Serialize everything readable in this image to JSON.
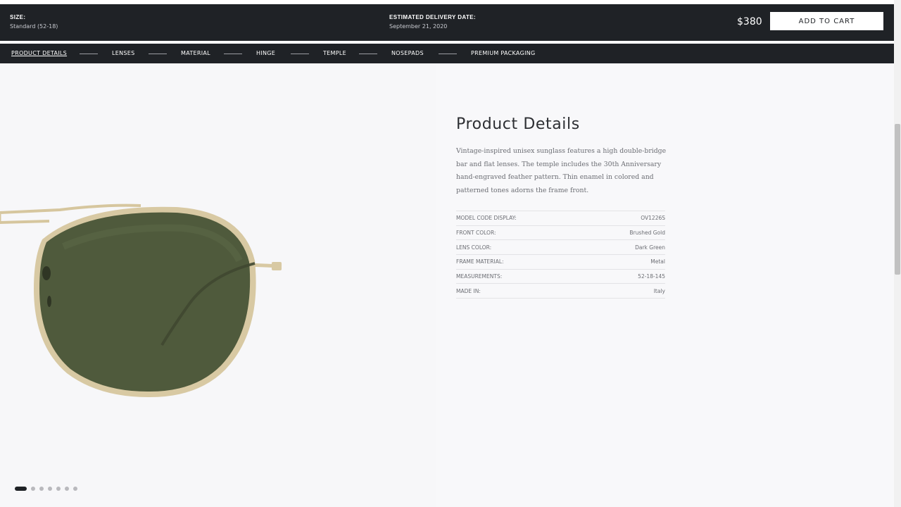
{
  "purchase_bar": {
    "size_label": "SIZE:",
    "size_value": "Standard (52-18)",
    "delivery_label": "ESTIMATED DELIVERY DATE:",
    "delivery_value": "September 21, 2020",
    "price": "$380",
    "add_to_cart_label": "ADD TO CART"
  },
  "section_nav": {
    "items": [
      {
        "label": "PRODUCT DETAILS",
        "active": true
      },
      {
        "label": "LENSES"
      },
      {
        "label": "MATERIAL"
      },
      {
        "label": "HINGE"
      },
      {
        "label": "TEMPLE"
      },
      {
        "label": "NOSEPADS"
      },
      {
        "label": "PREMIUM PACKAGING"
      }
    ]
  },
  "product": {
    "title": "Product Details",
    "description": "Vintage-inspired unisex sunglass features a high double-bridge bar and flat lenses. The temple includes the 30th Anniversary hand-engraved feather pattern. Thin enamel in colored and patterned tones adorns the frame front.",
    "specs": [
      {
        "label": "MODEL CODE DISPLAY:",
        "value": "OV1226S"
      },
      {
        "label": "FRONT COLOR:",
        "value": "Brushed Gold"
      },
      {
        "label": "LENS COLOR:",
        "value": "Dark Green"
      },
      {
        "label": "FRAME MATERIAL:",
        "value": "Metal"
      },
      {
        "label": "MEASUREMENTS:",
        "value": "52-18-145"
      },
      {
        "label": "MADE IN:",
        "value": "Italy"
      }
    ]
  },
  "carousel": {
    "total_slides": 7,
    "active_slide": 1
  },
  "colors": {
    "bar_background": "#1f2226",
    "frame_gold": "#d8c9a3",
    "lens_green": "#4f5a3c",
    "page_background": "#f7f7f9"
  }
}
